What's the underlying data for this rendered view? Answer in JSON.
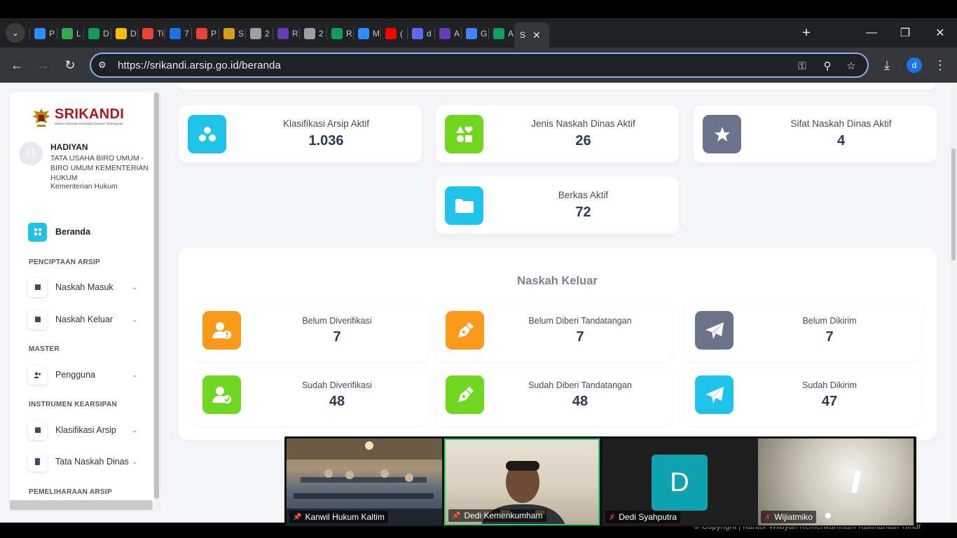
{
  "browser": {
    "tabs": [
      {
        "label": "P",
        "icon": "zoom-icon",
        "color": "#2d8cff"
      },
      {
        "label": "L",
        "icon": "drive-icon",
        "color": "#34a853"
      },
      {
        "label": "D",
        "icon": "sheets-icon",
        "color": "#0f9d58"
      },
      {
        "label": "D",
        "icon": "drive-icon",
        "color": "#fbbc04"
      },
      {
        "label": "Ti",
        "icon": "gmail-icon",
        "color": "#ea4335"
      },
      {
        "label": "7",
        "icon": "round-blue-icon",
        "color": "#1a73e8"
      },
      {
        "label": "P",
        "icon": "gmail-icon",
        "color": "#ea4335"
      },
      {
        "label": "S",
        "icon": "emblem-icon",
        "color": "#d4a017"
      },
      {
        "label": "2",
        "icon": "globe-icon",
        "color": "#9aa0a6"
      },
      {
        "label": "R",
        "icon": "forms-icon",
        "color": "#673ab7"
      },
      {
        "label": "2",
        "icon": "globe-icon",
        "color": "#9aa0a6"
      },
      {
        "label": "R",
        "icon": "sheets-icon",
        "color": "#0f9d58"
      },
      {
        "label": "M",
        "icon": "zoom-icon",
        "color": "#2d8cff"
      },
      {
        "label": "(",
        "icon": "youtube-icon",
        "color": "#ff0000"
      },
      {
        "label": "d",
        "icon": "d-round-icon",
        "color": "#5f6bff"
      },
      {
        "label": "A",
        "icon": "forms-icon",
        "color": "#673ab7"
      },
      {
        "label": "G",
        "icon": "docs-icon",
        "color": "#4285f4"
      },
      {
        "label": "A",
        "icon": "sheets-icon",
        "color": "#0f9d58"
      }
    ],
    "active_tab_label": "S",
    "url_host": "srikandi.arsip.go.id",
    "url_path": "/beranda",
    "url_scheme": "https://",
    "profile_initial": "d"
  },
  "sidebar": {
    "app_name": "SRIKANDI",
    "app_tagline": "Sistem Informasi Kearsipan Dinamis Terintegrasi",
    "user": {
      "initial": "H",
      "name": "HADIYAN",
      "unit": "TATA USAHA BIRO UMUM - BIRO UMUM KEMENTERIAN HUKUM",
      "institution": "Kementerian Hukum"
    },
    "menu_home": "Beranda",
    "sections": {
      "creation": "PENCIPTAAN ARSIP",
      "master": "MASTER",
      "instruments": "INSTRUMEN KEARSIPAN",
      "maintenance": "PEMELIHARAAN ARSIP"
    },
    "items": {
      "incoming": "Naskah Masuk",
      "outgoing": "Naskah Keluar",
      "users": "Pengguna",
      "classification": "Klasifikasi Arsip",
      "procedures": "Tata Naskah Dinas"
    }
  },
  "stats": {
    "klasifikasi": {
      "label": "Klasifikasi Arsip Aktif",
      "value": "1.036",
      "color": "#1fc2e8"
    },
    "jenis": {
      "label": "Jenis Naskah Dinas Aktif",
      "value": "26",
      "color": "#70d61f"
    },
    "sifat": {
      "label": "Sifat Naskah Dinas Aktif",
      "value": "4",
      "color": "#6c7289"
    },
    "berkas": {
      "label": "Berkas Aktif",
      "value": "72",
      "color": "#1fc2e8"
    }
  },
  "outgoing": {
    "title": "Naskah Keluar",
    "cards": {
      "unverified": {
        "label": "Belum Diverifikasi",
        "value": "7",
        "color": "#fb9a1a"
      },
      "unsigned": {
        "label": "Belum Diberi Tandatangan",
        "value": "7",
        "color": "#fb9a1a"
      },
      "unsent": {
        "label": "Belum Dikirim",
        "value": "7",
        "color": "#6c7289"
      },
      "verified": {
        "label": "Sudah Diverifikasi",
        "value": "48",
        "color": "#70d61f"
      },
      "signed": {
        "label": "Sudah Diberi Tandatangan",
        "value": "48",
        "color": "#70d61f"
      },
      "sent": {
        "label": "Sudah Dikirim",
        "value": "47",
        "color": "#1fc2e8"
      }
    }
  },
  "footer": {
    "copyright": "© Copyright | Kantor Wilayah Kemenkumham Kalimantan Timur"
  },
  "meeting": {
    "participants": [
      {
        "name": "Kanwil Hukum Kaltim"
      },
      {
        "name": "Dedi Kemenkumham"
      },
      {
        "name": "Dedi Syahputra",
        "initial": "D"
      },
      {
        "name": "Wijiatmiko"
      }
    ]
  }
}
